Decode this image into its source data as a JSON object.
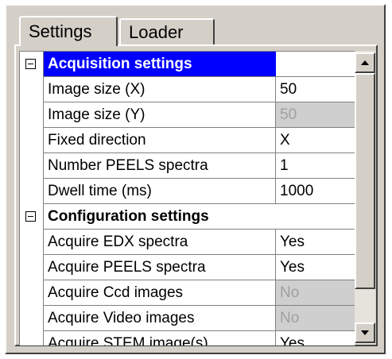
{
  "tabs": [
    {
      "label": "Settings",
      "active": true
    },
    {
      "label": "Loader",
      "active": false
    }
  ],
  "grid": {
    "categories": [
      {
        "label": "Acquisition settings",
        "expanded": true,
        "selected": true,
        "rows": [
          {
            "name": "Image size (X)",
            "value": "50",
            "disabled": false
          },
          {
            "name": "Image size (Y)",
            "value": "50",
            "disabled": true
          },
          {
            "name": "Fixed direction",
            "value": "X",
            "disabled": false
          },
          {
            "name": "Number PEELS spectra",
            "value": "1",
            "disabled": false
          },
          {
            "name": "Dwell time (ms)",
            "value": "1000",
            "disabled": false
          }
        ]
      },
      {
        "label": "Configuration settings",
        "expanded": true,
        "selected": false,
        "rows": [
          {
            "name": "Acquire EDX spectra",
            "value": "Yes",
            "disabled": false
          },
          {
            "name": "Acquire PEELS spectra",
            "value": "Yes",
            "disabled": false
          },
          {
            "name": "Acquire Ccd images",
            "value": "No",
            "disabled": true
          },
          {
            "name": "Acquire Video images",
            "value": "No",
            "disabled": true
          },
          {
            "name": "Acquire STEM image(s)",
            "value": "Yes",
            "disabled": false
          }
        ]
      }
    ]
  },
  "scrollbar": {
    "position": 0.0
  },
  "colors": {
    "selection": "#0000ff",
    "face": "#d4d0c8",
    "disabled_text": "#a0a0a0"
  },
  "icons": {
    "collapse": "collapse-minus-icon",
    "scroll_up": "scroll-up-arrow-icon",
    "scroll_down": "scroll-down-arrow-icon"
  }
}
